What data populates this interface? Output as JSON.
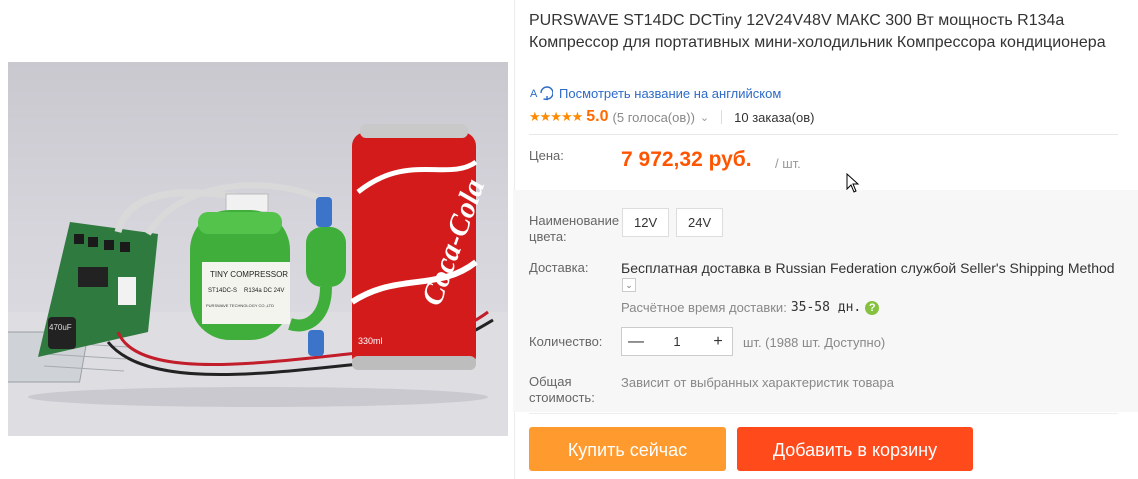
{
  "product": {
    "title": "PURSWAVE ST14DC DCTiny 12V24V48V МАКС 300 Вт мощность R134a Компрессор для портативных мини-холодильник Компрессора кондиционера",
    "translate_link": "Посмотреть название на английском",
    "translate_icon": "translate-icon",
    "image_labels": {
      "compressor_brand": "TINY COMPRESSOR",
      "compressor_model": "ST14DC-S",
      "compressor_spec": "R134a  DC  24V",
      "compressor_maker": "PURSWAVE TECHNOLOGY CO.,LTD",
      "can_brand": "Coca-Cola",
      "can_volume": "330ml",
      "capacitor_label": "470uF"
    }
  },
  "rating": {
    "stars": "★★★★★",
    "value": "5.0",
    "votes": "(5 голоса(ов))",
    "orders": "10 заказа(ов)"
  },
  "price": {
    "label": "Цена:",
    "value": "7 972,32 руб.",
    "unit": "/ шт.",
    "color": "#ff5500"
  },
  "options": {
    "color_label": "Наименование цвета:",
    "colors": [
      "12V",
      "24V"
    ]
  },
  "delivery": {
    "label": "Доставка:",
    "text": "Бесплатная доставка в Russian Federation службой Seller's Shipping Method",
    "eta_label": "Расчётное время доставки:",
    "eta_days": "35-58 дн.",
    "help_icon": "?"
  },
  "quantity": {
    "label": "Количество:",
    "value": "1",
    "minus": "—",
    "plus": "+",
    "available": "шт. (1988 шт. Доступно)"
  },
  "total": {
    "label": "Общая стоимость:",
    "value": "Зависит от выбранных характеристик товара"
  },
  "buttons": {
    "buy_now": "Купить сейчас",
    "add_to_cart": "Добавить в корзину",
    "buy_color": "#ff9a2e",
    "cart_color": "#ff4a1c"
  }
}
